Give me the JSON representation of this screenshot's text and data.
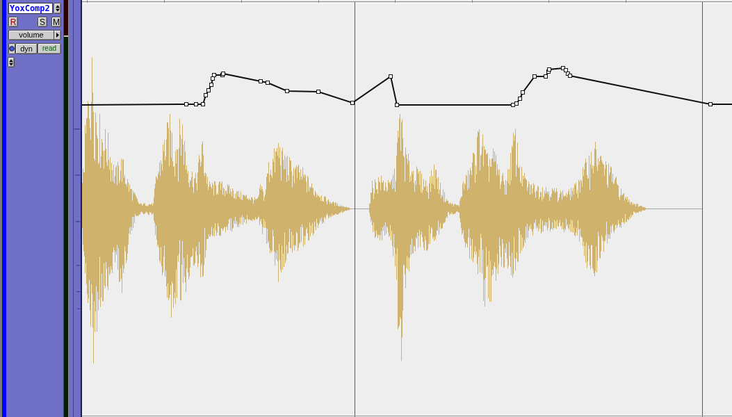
{
  "track": {
    "name": "YoxComp2",
    "buttons": [
      {
        "kind": "record",
        "label": "R"
      },
      {
        "kind": "solo",
        "label": "S"
      },
      {
        "kind": "mute",
        "label": "M"
      }
    ],
    "view_selector": "volume",
    "automation": {
      "mode": "dyn",
      "state": "read"
    }
  }
}
